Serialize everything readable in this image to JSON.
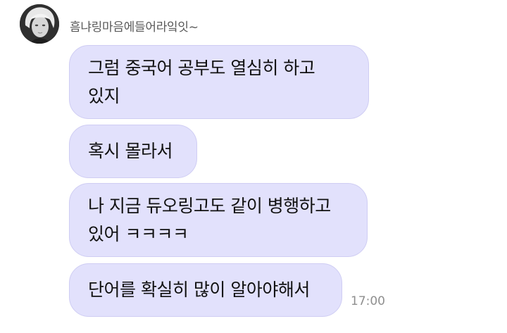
{
  "chat": {
    "sender": {
      "name": "흠냐링마음에들어라잌잇~",
      "avatar_icon": "profile-photo"
    },
    "messages": [
      {
        "lines": [
          "그럼 중국어 공부도 열심히 하고",
          "있지"
        ]
      },
      {
        "lines": [
          "혹시 몰라서"
        ]
      },
      {
        "lines": [
          "나 지금 듀오링고도 같이 병행하고",
          "있어 ㅋㅋㅋㅋ"
        ]
      },
      {
        "lines": [
          "단어를 확실히 많이 알아야해서"
        ]
      }
    ],
    "last_message_time": "17:00",
    "bubble_color": "#e2e1fc",
    "bubble_border_color": "#cfcdf3"
  }
}
